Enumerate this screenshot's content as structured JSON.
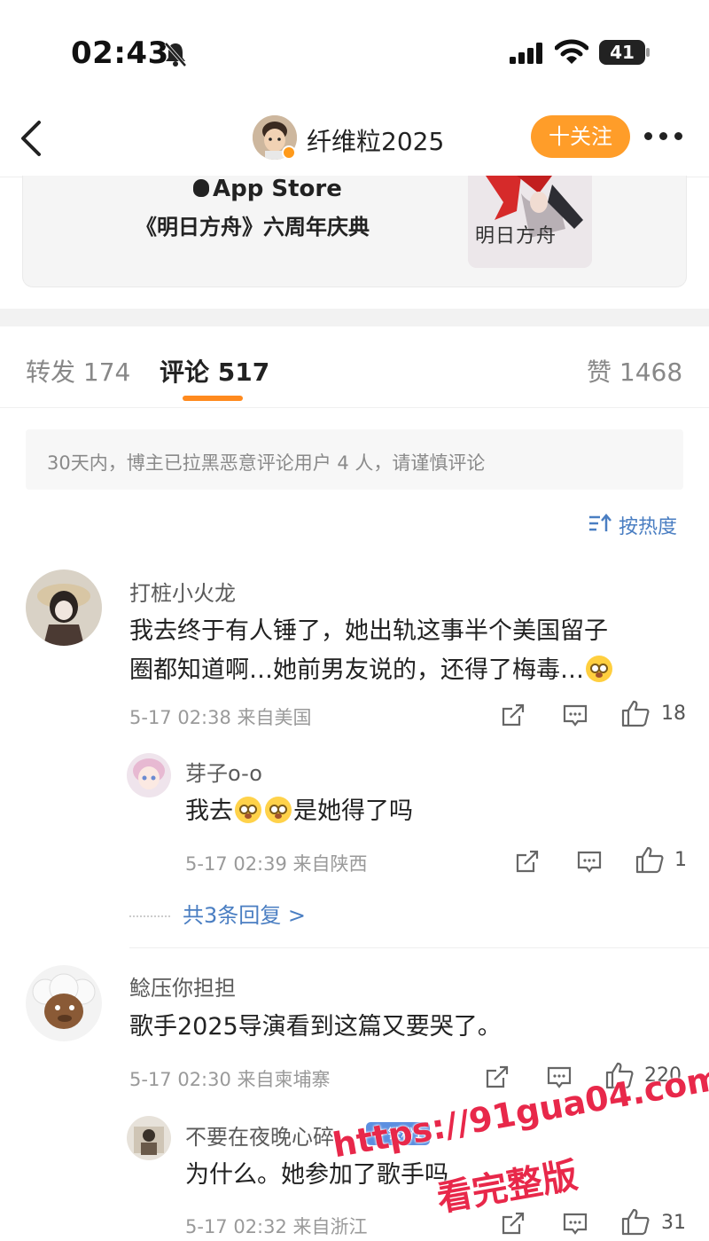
{
  "status_bar": {
    "time": "02:43",
    "battery": "41"
  },
  "header": {
    "user_name": "纤维粒2025",
    "follow_label": "十关注"
  },
  "card": {
    "store": "App Store",
    "title": "《明日方舟》六周年庆典",
    "thumb_text": "明日方舟"
  },
  "tabs": [
    {
      "label": "转发 174"
    },
    {
      "label": "评论 517"
    },
    {
      "label": "赞 1468"
    }
  ],
  "notice": "30天内，博主已拉黑恶意评论用户 4 人，请谨慎评论",
  "sort_label": "按热度",
  "comments": [
    {
      "user": "打桩小火龙",
      "text_line1": "我去终于有人锤了，她出轨这事半个美国留子",
      "text_line2": "圈都知道啊…她前男友说的，还得了梅毒…",
      "meta": "5-17 02:38  来自美国",
      "likes": "18",
      "replies": [
        {
          "user": "芽子o-o",
          "text_a": "我去",
          "text_b": "是她得了吗",
          "meta": "5-17 02:39  来自陕西",
          "likes": "1"
        }
      ],
      "more_replies": "共3条回复 >"
    },
    {
      "user": "鲶压你担担",
      "text": "歌手2025导演看到这篇又要哭了。",
      "meta": "5-17 02:30  来自柬埔寨",
      "likes": "220",
      "replies": [
        {
          "user": "不要在夜晚心碎",
          "badge": "铁粉1",
          "text": "为什么。她参加了歌手吗",
          "meta": "5-17 02:32  来自浙江",
          "likes": "31"
        }
      ]
    }
  ],
  "watermark": {
    "url": "https://91gua04.com",
    "caption": "看完整版"
  },
  "colors": {
    "accent_orange": "#ff9d29",
    "link_blue": "#4a7ec2",
    "watermark_red": "#e8284a"
  }
}
